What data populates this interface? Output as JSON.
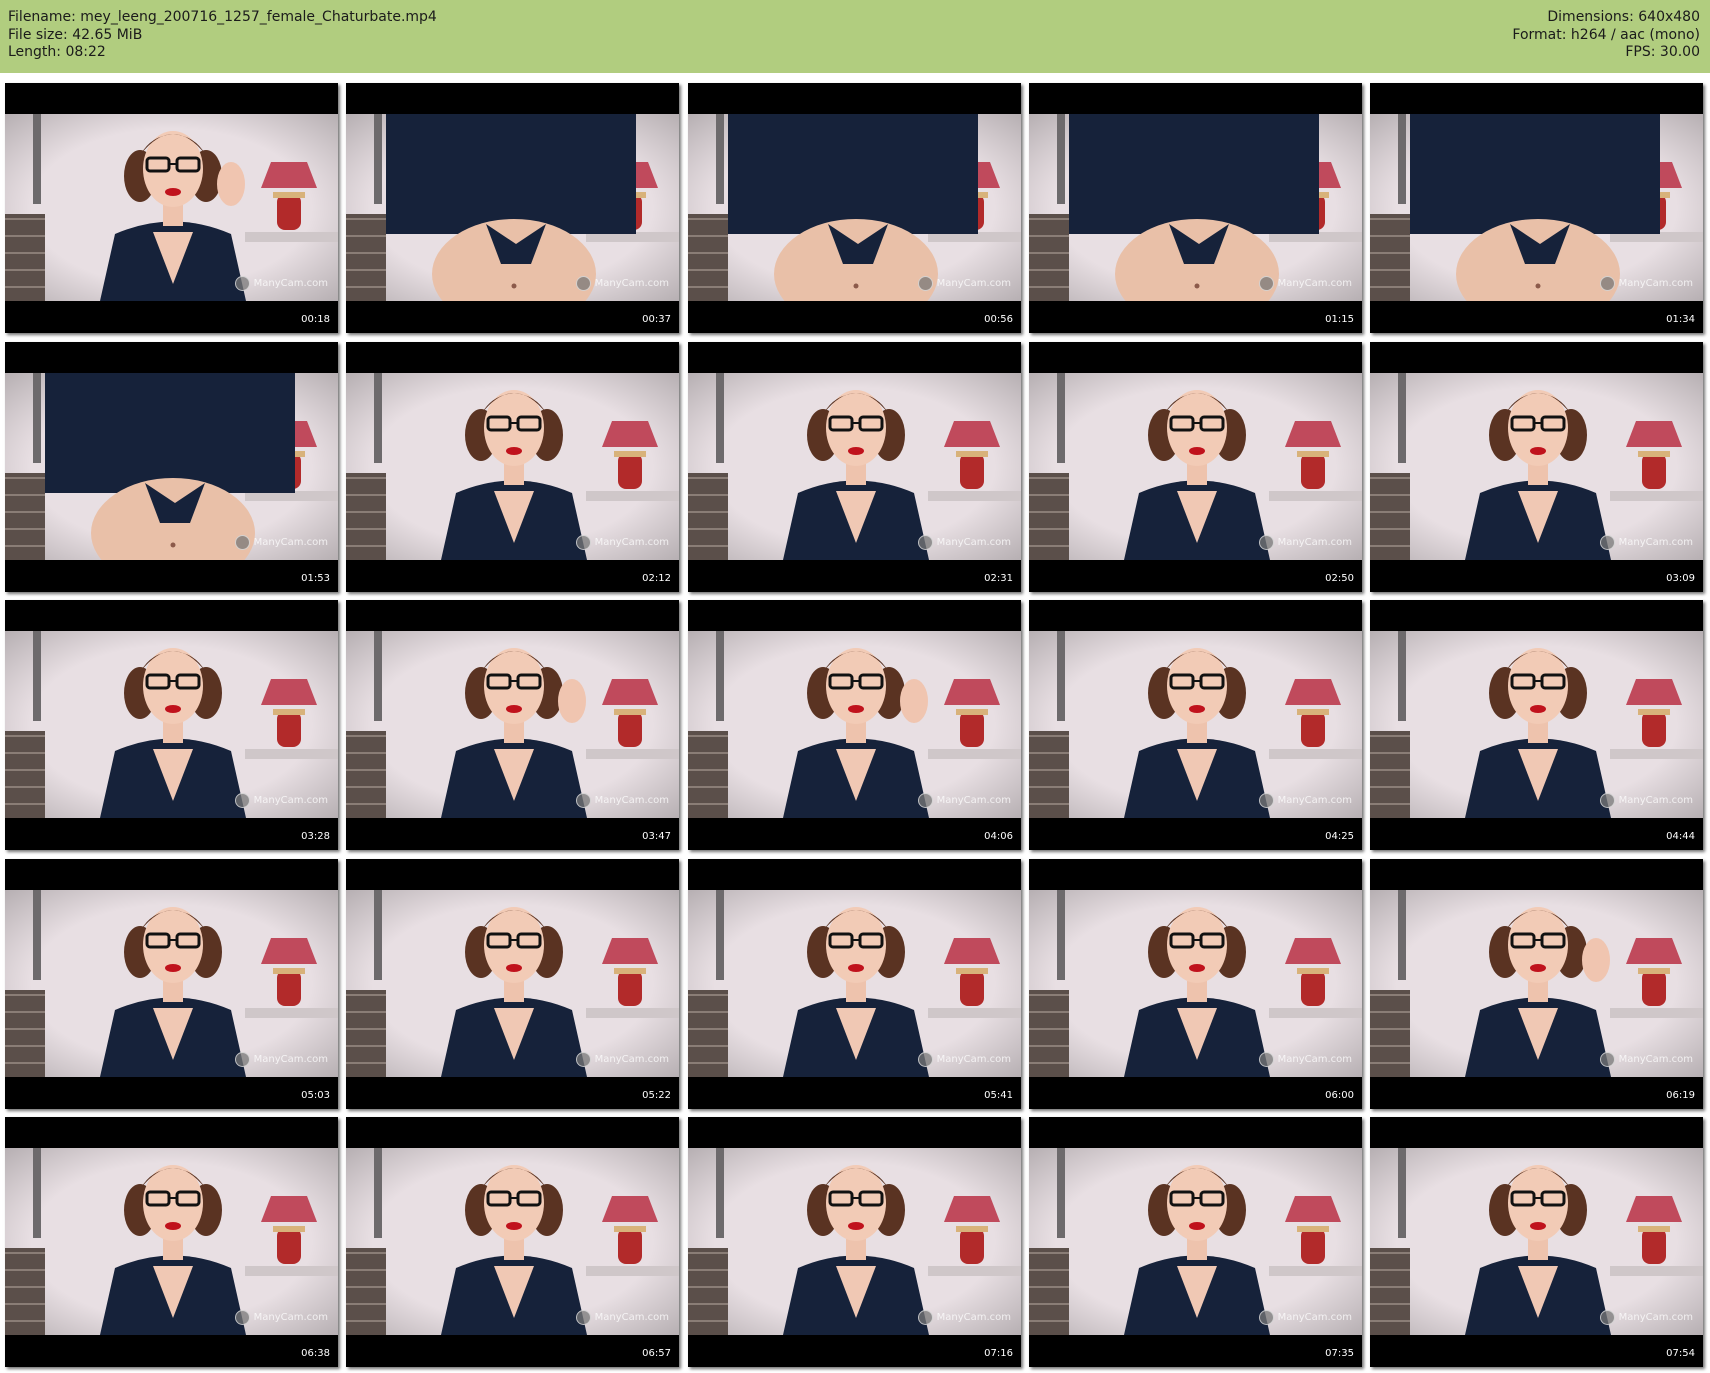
{
  "file_info": {
    "filename_line": "Filename: mey_leeng_200716_1257_female_Chaturbate.mp4",
    "filesize_line": "File size: 42.65 MiB",
    "length_line": "Length: 08:22",
    "dimensions_line": "Dimensions: 640x480",
    "format_line": "Format: h264 / aac (mono)",
    "fps_line": "FPS: 30.00"
  },
  "colors": {
    "header_bg": "#b1cd7f",
    "thumb_border": "#000000",
    "room_wall": "#e8dfe3",
    "shirt": "#16223a",
    "lips": "#c0121c",
    "lamp_shade": "#c04a5c"
  },
  "watermark_text": "ManyCam.com",
  "thumbnails": [
    {
      "time": "00:18",
      "pose": "face-hand"
    },
    {
      "time": "00:37",
      "pose": "torso"
    },
    {
      "time": "00:56",
      "pose": "torso"
    },
    {
      "time": "01:15",
      "pose": "torso"
    },
    {
      "time": "01:34",
      "pose": "torso"
    },
    {
      "time": "01:53",
      "pose": "torso"
    },
    {
      "time": "02:12",
      "pose": "face"
    },
    {
      "time": "02:31",
      "pose": "face"
    },
    {
      "time": "02:50",
      "pose": "face"
    },
    {
      "time": "03:09",
      "pose": "face"
    },
    {
      "time": "03:28",
      "pose": "face"
    },
    {
      "time": "03:47",
      "pose": "face-hand"
    },
    {
      "time": "04:06",
      "pose": "face-hand"
    },
    {
      "time": "04:25",
      "pose": "face"
    },
    {
      "time": "04:44",
      "pose": "face"
    },
    {
      "time": "05:03",
      "pose": "face"
    },
    {
      "time": "05:22",
      "pose": "face"
    },
    {
      "time": "05:41",
      "pose": "face"
    },
    {
      "time": "06:00",
      "pose": "face"
    },
    {
      "time": "06:19",
      "pose": "face-hand"
    },
    {
      "time": "06:38",
      "pose": "face"
    },
    {
      "time": "06:57",
      "pose": "face"
    },
    {
      "time": "07:16",
      "pose": "face"
    },
    {
      "time": "07:35",
      "pose": "face"
    },
    {
      "time": "07:54",
      "pose": "face"
    }
  ]
}
